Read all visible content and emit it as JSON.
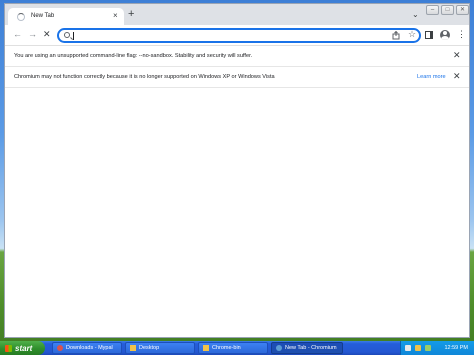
{
  "browser": {
    "tab_title": "New Tab",
    "tab_close": "×",
    "new_tab": "+",
    "tab_menu": "⌄",
    "window_buttons": {
      "minimize": "–",
      "maximize": "□",
      "close": "✕"
    },
    "nav": {
      "back": "←",
      "forward": "→",
      "stop": "✕"
    },
    "omnibox": {
      "value": "",
      "placeholder": ""
    },
    "icons": {
      "share": "share-icon",
      "star": "☆",
      "menu": "⋮"
    }
  },
  "infobars": [
    {
      "message": "You are using an unsupported command-line flag: --no-sandbox. Stability and security will suffer.",
      "link": "",
      "close": "✕"
    },
    {
      "message": "Chromium may not function correctly because it is no longer supported on Windows XP or Windows Vista",
      "link": "Learn more",
      "close": "✕"
    }
  ],
  "taskbar": {
    "start_label": "start",
    "tasks": [
      {
        "label": "Downloads - Mypal",
        "icon_color": "#d9534f"
      },
      {
        "label": "Desktop",
        "icon_color": "#f0c24a"
      },
      {
        "label": "Chrome-bin",
        "icon_color": "#f0c24a"
      },
      {
        "label": "New Tab - Chromium",
        "icon_color": "#5b9bd5"
      }
    ],
    "clock": "12:59 PM"
  },
  "colors": {
    "accent": "#1a73e8",
    "taskbar": "#245edb",
    "start": "#2f8f2c"
  }
}
